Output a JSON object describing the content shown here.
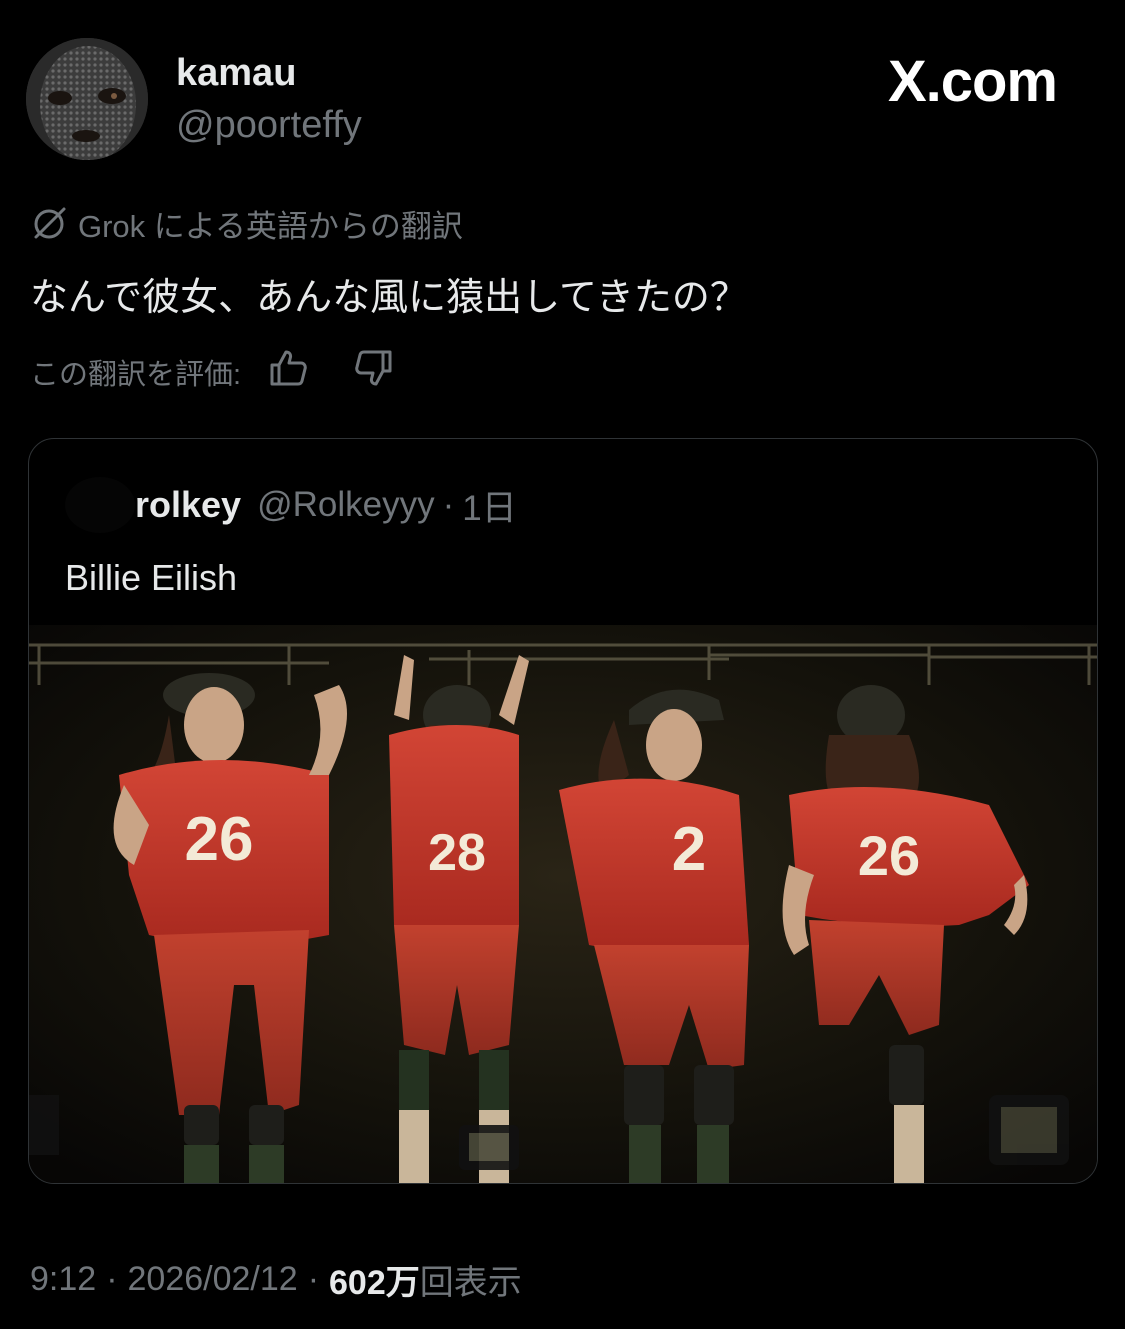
{
  "author": {
    "display_name": "kamau",
    "handle": "@poorteffy",
    "avatar_icon": "masked-person-avatar"
  },
  "brand": {
    "label": "X.com"
  },
  "translation": {
    "label": "Grok による英語からの翻訳",
    "icon": "slashed-circle-icon"
  },
  "tweet": {
    "text": "なんで彼女、あんな風に猿出してきたの？"
  },
  "rating": {
    "label": "この翻訳を評価:",
    "thumbs_up_icon": "thumbs-up-icon",
    "thumbs_down_icon": "thumbs-down-icon"
  },
  "quote": {
    "display_name": "rolkey",
    "handle": "@Rolkeyyy",
    "separator": "·",
    "time": "1日",
    "text": "Billie Eilish",
    "media_description_icon": "concert-photo"
  },
  "footer": {
    "time": "9:12",
    "sep1": "·",
    "date": "2026/02/12",
    "sep2": "·",
    "views_count": "602万",
    "views_label": "回表示"
  },
  "colors": {
    "background": "#000000",
    "primary_text": "#e7e9ea",
    "secondary_text": "#71767b",
    "border": "#2f3336",
    "jersey_red": "#c83a2c"
  }
}
